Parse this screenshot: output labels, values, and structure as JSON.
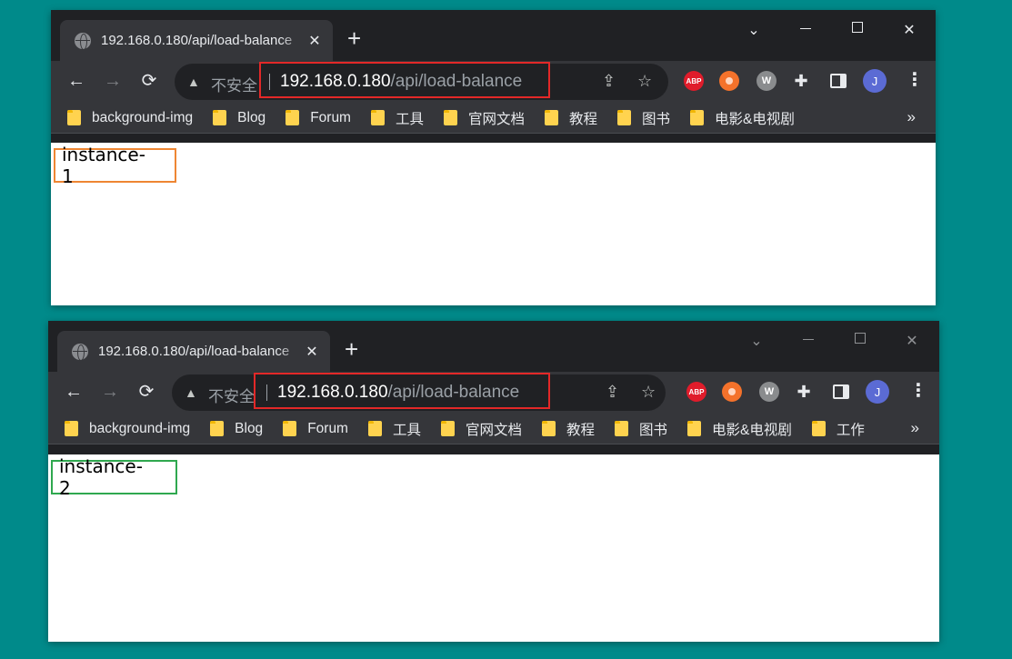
{
  "windows": [
    {
      "tab_title": "192.168.0.180/api/load-balance",
      "url_host": "192.168.0.180",
      "url_path": "/api/load-balance",
      "security_label": "不安全",
      "response_text": "instance-1",
      "highlight_color": "#ee8633",
      "bookmarks": [
        "background-img",
        "Blog",
        "Forum",
        "工具",
        "官网文档",
        "教程",
        "图书",
        "电影&电视剧"
      ],
      "avatar_initial": "J"
    },
    {
      "tab_title": "192.168.0.180/api/load-balance",
      "url_host": "192.168.0.180",
      "url_path": "/api/load-balance",
      "security_label": "不安全",
      "response_text": "instance-2",
      "highlight_color": "#2fa84f",
      "bookmarks": [
        "background-img",
        "Blog",
        "Forum",
        "工具",
        "官网文档",
        "教程",
        "图书",
        "电影&电视剧",
        "工作"
      ],
      "avatar_initial": "J"
    }
  ],
  "icons": {
    "back": "←",
    "forward": "→",
    "reload": "⟳",
    "new_tab": "+",
    "close_tab": "✕",
    "minimize": "–",
    "restore": "☐",
    "close_window": "✕",
    "tab_list": "⌄",
    "share": "⇪",
    "star": "☆",
    "warning": "▲",
    "abp": "ABP",
    "w_ext": "W",
    "puzzle": "✚",
    "menu": "⋮",
    "bookmarks_more": "»"
  },
  "colors": {
    "desktop": "#008a8a",
    "url_highlight_box": "#e32828"
  }
}
